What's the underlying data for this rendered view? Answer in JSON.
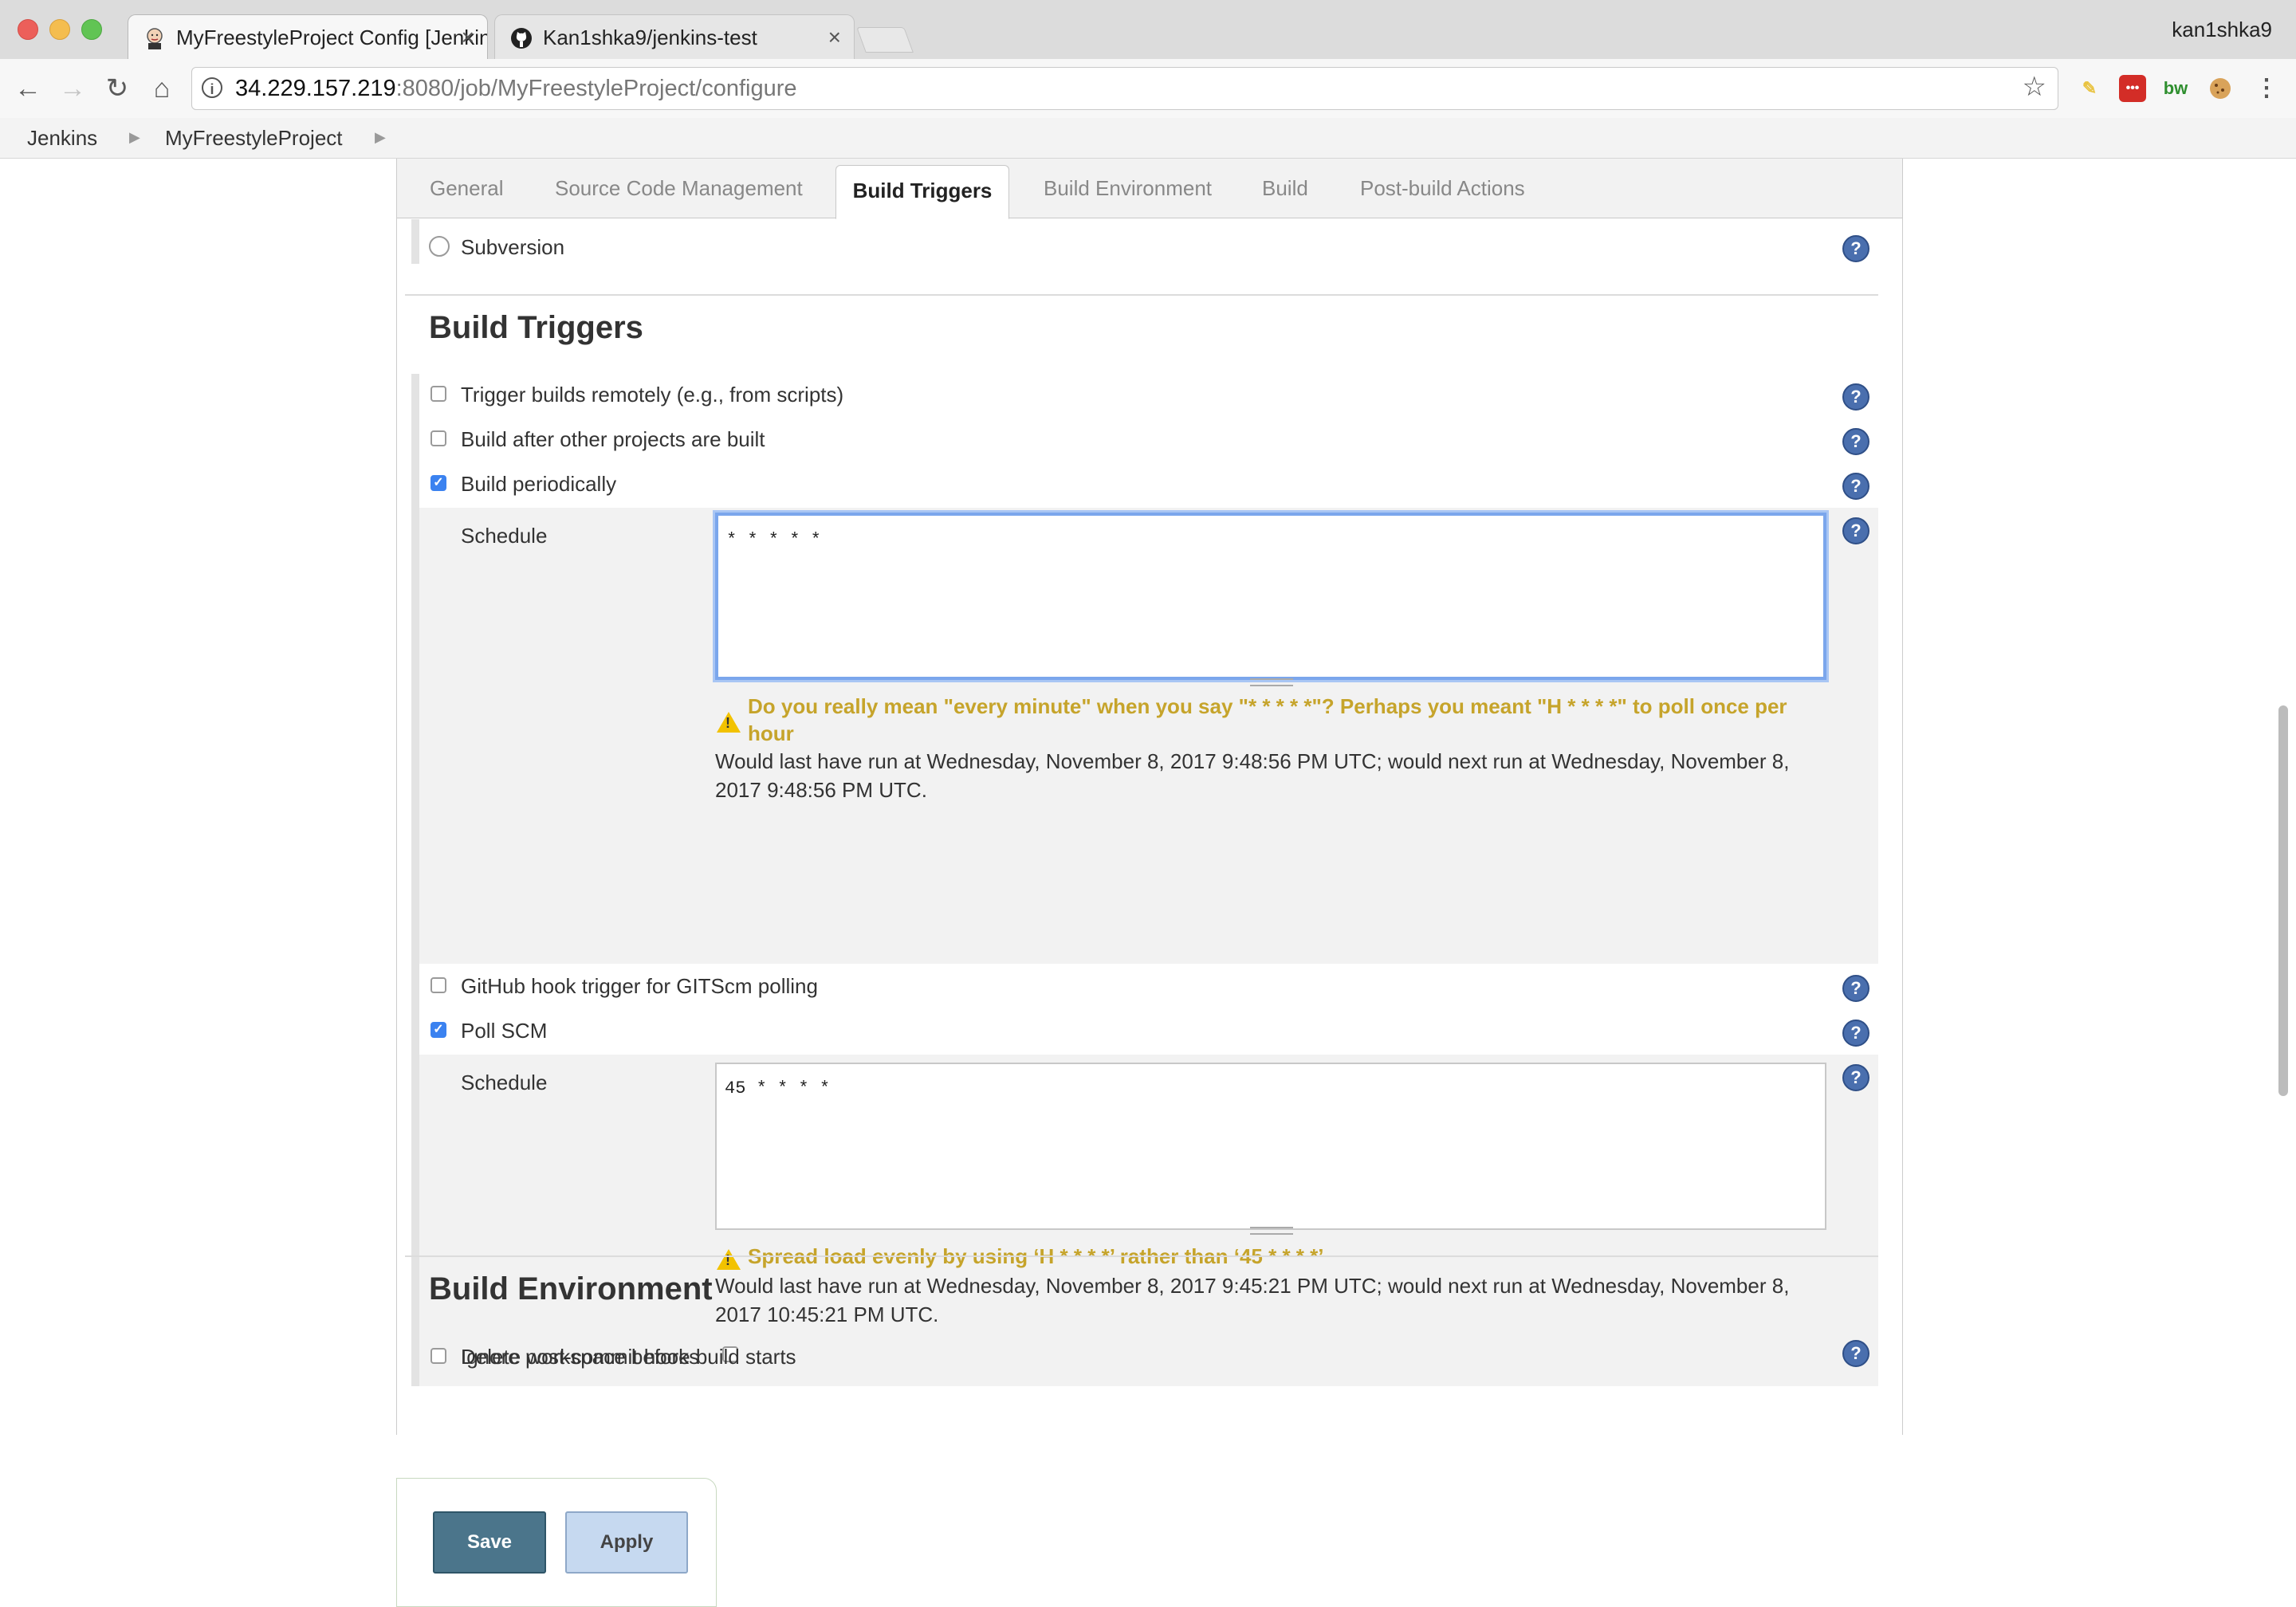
{
  "browser": {
    "tabs": [
      {
        "title": "MyFreestyleProject Config [Jenkins]",
        "icon": "jenkins-butler-icon",
        "active": true
      },
      {
        "title": "Kan1shka9/jenkins-test",
        "icon": "github-octocat-icon",
        "active": false
      }
    ],
    "profile": "kan1shka9",
    "url_host": "34.229.157.219",
    "url_rest": ":8080/job/MyFreestyleProject/configure",
    "extensions": [
      "sticky-note-icon",
      "lastpass-icon",
      "bitwarden-icon",
      "cookie-icon"
    ],
    "close_glyph": "×"
  },
  "breadcrumbs": [
    "Jenkins",
    "MyFreestyleProject"
  ],
  "config_tabs": {
    "items": [
      "General",
      "Source Code Management",
      "Build Triggers",
      "Build Environment",
      "Build",
      "Post-build Actions"
    ],
    "active": "Build Triggers"
  },
  "scm": {
    "subversion_label": "Subversion"
  },
  "build_triggers": {
    "title": "Build Triggers",
    "trigger_remotely": {
      "label": "Trigger builds remotely (e.g., from scripts)",
      "checked": false
    },
    "after_other": {
      "label": "Build after other projects are built",
      "checked": false
    },
    "periodically": {
      "label": "Build periodically",
      "checked": true,
      "schedule_label": "Schedule",
      "schedule_value": "* * * * *",
      "warning": "Do you really mean \"every minute\" when you say \"* * * * *\"? Perhaps you meant \"H * * * *\" to poll once per hour",
      "info": "Would last have run at Wednesday, November 8, 2017 9:48:56 PM UTC; would next run at Wednesday, November 8, 2017 9:48:56 PM UTC."
    },
    "github_hook": {
      "label": "GitHub hook trigger for GITScm polling",
      "checked": false
    },
    "poll_scm": {
      "label": "Poll SCM",
      "checked": true,
      "schedule_label": "Schedule",
      "schedule_value": "45 * * * *",
      "warning": "Spread load evenly by using ‘H * * * *’ rather than ‘45 * * * *’",
      "info": "Would last have run at Wednesday, November 8, 2017 9:45:21 PM UTC; would next run at Wednesday, November 8, 2017 10:45:21 PM UTC.",
      "ignore_hooks_label": "Ignore post-commit hooks",
      "ignore_hooks_checked": false
    }
  },
  "build_environment": {
    "title": "Build Environment",
    "first_option_partial": "Delete workspace before build starts"
  },
  "actions": {
    "save": "Save",
    "apply": "Apply"
  },
  "help_glyph": "?",
  "check_glyph": "✓",
  "warn_glyph": "!"
}
